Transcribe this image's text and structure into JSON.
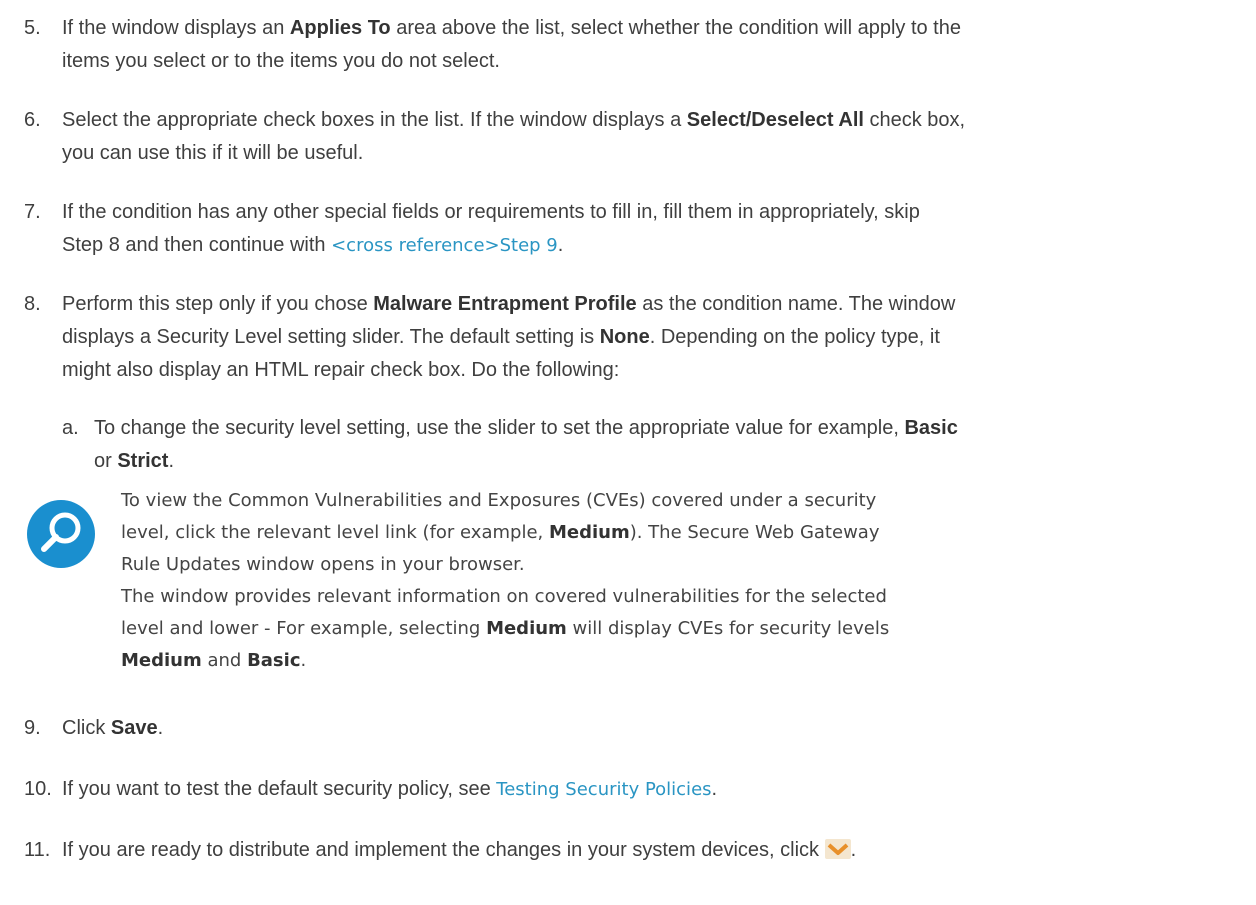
{
  "steps": {
    "s5": {
      "num": "5.",
      "p1": "If the window displays an ",
      "b1": "Applies To",
      "p2": " area above the list, select whether the condition will apply to the",
      "line2": "items you select or to the items you do not select."
    },
    "s6": {
      "num": "6.",
      "p1": "Select the appropriate check boxes in the list. If the window displays a ",
      "b1": "Select/Deselect All",
      "p2": " check box,",
      "line2": "you can use this if it will be useful."
    },
    "s7": {
      "num": "7.",
      "line1": "If the condition has any other special fields or requirements to fill in, fill them in appropriately, skip",
      "p2": "Step 8 and then continue with ",
      "link": "<cross reference>Step 9",
      "p3": "."
    },
    "s8": {
      "num": "8.",
      "p1": "Perform this step only if you chose ",
      "b1": "Malware Entrapment Profile",
      "p2": " as the condition name. The window",
      "p3": "displays a Security Level setting slider. The default setting is ",
      "b2": "None",
      "p4": ". Depending on the policy type, it",
      "line3": "might also display an HTML repair check box. Do the following:"
    },
    "s8a": {
      "num": "a.",
      "p1": "To change the security level setting, use the slider to set the appropriate value for example, ",
      "b1": "Basic",
      "p2": "or ",
      "b2": "Strict",
      "p3": "."
    },
    "s9": {
      "num": "9.",
      "p1": "Click ",
      "b1": "Save",
      "p2": "."
    },
    "s10": {
      "num": "10.",
      "p1": "If you want to test the default security policy, see ",
      "link": "Testing Security Policies",
      "p2": "."
    },
    "s11": {
      "num": "11.",
      "p1": "If you are ready to distribute and implement the changes in your system devices, click ",
      "p2": "."
    }
  },
  "note": {
    "icon": "magnifier-icon",
    "l1": "To view the Common Vulnerabilities and Exposures (CVEs) covered under a security",
    "l2a": "level, click the relevant level link (for example, ",
    "l2b": "Medium",
    "l2c": "). The Secure Web Gateway",
    "l3": "Rule Updates window opens in your browser.",
    "l4": "The window provides relevant information on covered vulnerabilities for the selected",
    "l5a": "level and lower - For example, selecting ",
    "l5b": "Medium",
    "l5c": " will display CVEs for security levels",
    "l6a": "Medium",
    "l6b": " and ",
    "l6c": "Basic",
    "l6d": "."
  },
  "colors": {
    "text": "#3f3f3f",
    "link": "#2a95c3",
    "icon": "#1a8fcf",
    "deploy": "#e8902a"
  },
  "deploy_icon": "deploy-chevron-icon"
}
